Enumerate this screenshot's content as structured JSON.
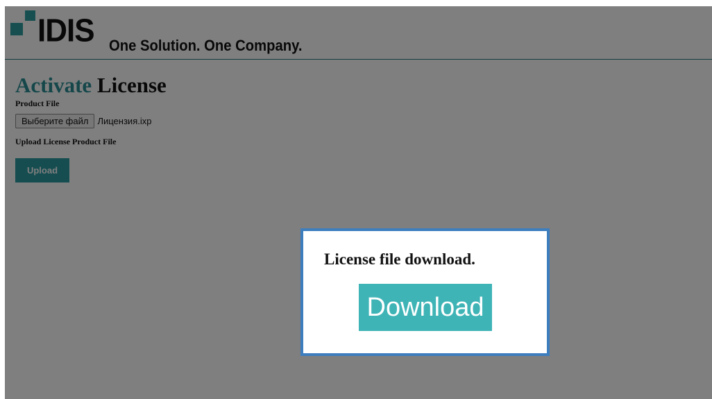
{
  "header": {
    "logo_text": "IDIS",
    "slogan": "One Solution. One Company."
  },
  "main": {
    "title_accent": "Activate",
    "title_rest": "License",
    "product_file_label": "Product File",
    "choose_file_label": "Выберите файл",
    "file_name": "Лицензия.ixp",
    "upload_section_label": "Upload License Product File",
    "upload_label": "Upload"
  },
  "modal": {
    "title": "License file download.",
    "download_label": "Download"
  },
  "colors": {
    "accent": "#2a8f95",
    "download_button": "#3fb4b6",
    "modal_border": "#3d7ebf",
    "overlay": "rgba(0,0,0,0.5)"
  }
}
